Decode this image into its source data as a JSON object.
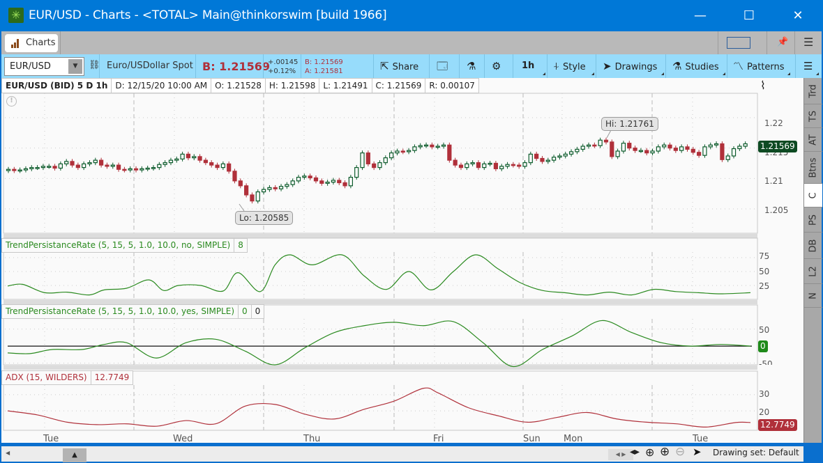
{
  "window": {
    "title": "EUR/USD - Charts - <TOTAL> Main@thinkorswim [build 1966]",
    "minimize": "—",
    "maximize": "☐",
    "close": "✕"
  },
  "tabbar": {
    "active_tab": "Charts"
  },
  "toolbar": {
    "symbol": "EUR/USD",
    "description": "Euro/USDollar Spot",
    "bid_big": "B: 1.21569",
    "change": "+.00145",
    "change_pct": "+0.12%",
    "bid": "B: 1.21569",
    "ask": "A: 1.21581",
    "share": "Share",
    "timeframe": "1h",
    "style": "Style",
    "drawings": "Drawings",
    "studies": "Studies",
    "patterns": "Patterns"
  },
  "infobar": {
    "title": "EUR/USD (BID) 5 D 1h",
    "date": "D: 12/15/20 10:00 AM",
    "open": "O: 1.21528",
    "high": "H: 1.21598",
    "low": "L: 1.21491",
    "close": "C: 1.21569",
    "range": "R: 0.00107"
  },
  "sidetabs": [
    "Trd",
    "TS",
    "AT",
    "Btns",
    "C",
    "PS",
    "DB",
    "L2",
    "N"
  ],
  "sidetab_active": "C",
  "price_axis": {
    "ticks": [
      "1.22",
      "1.215",
      "1.21",
      "1.205"
    ],
    "last": "1.21569"
  },
  "callouts": {
    "high": "Hi: 1.21761",
    "low": "Lo: 1.20585"
  },
  "panels": {
    "tpr_no": {
      "label": "TrendPersistanceRate (5, 15, 5, 1.0, 10.0, no, SIMPLE)",
      "value": "8",
      "ticks": [
        "75",
        "50",
        "25"
      ]
    },
    "tpr_yes": {
      "label": "TrendPersistanceRate (5, 15, 5, 1.0, 10.0, yes, SIMPLE)",
      "value1": "0",
      "value2": "0",
      "ticks": [
        "50",
        "-50"
      ],
      "last": "0"
    },
    "adx": {
      "label": "ADX (15, WILDERS)",
      "value": "12.7749",
      "ticks": [
        "30",
        "20"
      ],
      "last": "12.7749"
    }
  },
  "x_axis": [
    "Tue",
    "Wed",
    "Thu",
    "Fri",
    "Sun",
    "Mon",
    "Tue"
  ],
  "status": {
    "drawing_set": "Drawing set: Default"
  },
  "colors": {
    "up": "#0b5a2a",
    "down": "#b0303a",
    "tpr": "#2a8a1f",
    "adx": "#b0303a",
    "accent": "#0078d7",
    "toolbar": "#97dcfb"
  },
  "chart_data": [
    {
      "type": "candlestick",
      "title": "EUR/USD (BID) 5 D 1h",
      "ylim": [
        1.201,
        1.224
      ],
      "yticks": [
        1.205,
        1.21,
        1.215,
        1.22
      ],
      "close": [
        1.2115,
        1.2113,
        1.2114,
        1.2116,
        1.2118,
        1.2118,
        1.212,
        1.212,
        1.2117,
        1.2124,
        1.2128,
        1.2122,
        1.2118,
        1.2124,
        1.2126,
        1.213,
        1.2122,
        1.212,
        1.2122,
        1.2115,
        1.2114,
        1.2116,
        1.2114,
        1.2116,
        1.2117,
        1.2118,
        1.2123,
        1.2126,
        1.213,
        1.2132,
        1.214,
        1.2134,
        1.2136,
        1.213,
        1.2126,
        1.2122,
        1.2118,
        1.2124,
        1.2112,
        1.2096,
        1.2088,
        1.2073,
        1.2063,
        1.2078,
        1.2082,
        1.2085,
        1.2083,
        1.2087,
        1.209,
        1.2096,
        1.2102,
        1.2104,
        1.2101,
        1.2096,
        1.2092,
        1.2094,
        1.2097,
        1.2093,
        1.2088,
        1.2102,
        1.2118,
        1.2142,
        1.2124,
        1.2118,
        1.2126,
        1.2134,
        1.2142,
        1.2145,
        1.2144,
        1.2146,
        1.2152,
        1.2154,
        1.2155,
        1.2152,
        1.2153,
        1.2155,
        1.213,
        1.2122,
        1.2118,
        1.2124,
        1.2126,
        1.2118,
        1.2124,
        1.2125,
        1.2116,
        1.212,
        1.2123,
        1.2122,
        1.212,
        1.2126,
        1.214,
        1.2133,
        1.2128,
        1.213,
        1.2135,
        1.2137,
        1.214,
        1.2144,
        1.2148,
        1.2153,
        1.2155,
        1.2154,
        1.2163,
        1.216,
        1.2136,
        1.2145,
        1.2158,
        1.215,
        1.2146,
        1.2146,
        1.2142,
        1.2145,
        1.2152,
        1.2155,
        1.215,
        1.2146,
        1.2152,
        1.2148,
        1.2143,
        1.2138,
        1.2152,
        1.2155,
        1.2157,
        1.2131,
        1.2137,
        1.2149,
        1.2153,
        1.2157
      ]
    },
    {
      "type": "line",
      "title": "TrendPersistanceRate (5, 15, 5, 1.0, 10.0, no, SIMPLE)",
      "ylim": [
        0,
        85
      ],
      "yticks": [
        25,
        50,
        75
      ],
      "x": [
        0,
        0.02,
        0.05,
        0.08,
        0.11,
        0.13,
        0.16,
        0.19,
        0.21,
        0.23,
        0.26,
        0.29,
        0.31,
        0.34,
        0.36,
        0.38,
        0.41,
        0.45,
        0.48,
        0.51,
        0.54,
        0.57,
        0.6,
        0.63,
        0.66,
        0.69,
        0.72,
        0.75,
        0.78,
        0.81,
        0.84,
        0.87,
        0.9,
        0.93,
        0.96,
        1.0
      ],
      "values": [
        24,
        27,
        12,
        13,
        8,
        17,
        20,
        35,
        16,
        25,
        25,
        15,
        48,
        14,
        62,
        80,
        62,
        80,
        42,
        18,
        50,
        17,
        50,
        80,
        55,
        30,
        16,
        12,
        8,
        13,
        8,
        18,
        14,
        12,
        10,
        12
      ]
    },
    {
      "type": "line",
      "title": "TrendPersistanceRate (5, 15, 5, 1.0, 10.0, yes, SIMPLE)",
      "ylim": [
        -55,
        80
      ],
      "yticks": [
        -50,
        50
      ],
      "x": [
        0,
        0.03,
        0.06,
        0.1,
        0.13,
        0.16,
        0.2,
        0.24,
        0.28,
        0.32,
        0.36,
        0.4,
        0.44,
        0.48,
        0.52,
        0.56,
        0.6,
        0.64,
        0.68,
        0.72,
        0.76,
        0.8,
        0.84,
        0.88,
        0.92,
        0.96,
        1.0
      ],
      "values": [
        -20,
        -22,
        -10,
        -10,
        5,
        10,
        -35,
        10,
        20,
        -15,
        -55,
        -5,
        40,
        60,
        70,
        60,
        72,
        10,
        -60,
        -10,
        30,
        75,
        40,
        10,
        0,
        5,
        0
      ]
    },
    {
      "type": "line",
      "title": "ADX (15, WILDERS)",
      "ylim": [
        8,
        36
      ],
      "yticks": [
        20,
        30
      ],
      "x": [
        0,
        0.04,
        0.08,
        0.12,
        0.16,
        0.2,
        0.24,
        0.28,
        0.32,
        0.36,
        0.4,
        0.44,
        0.48,
        0.52,
        0.56,
        0.58,
        0.62,
        0.66,
        0.7,
        0.74,
        0.78,
        0.82,
        0.86,
        0.9,
        0.94,
        0.98,
        1.0
      ],
      "values": [
        20,
        17.5,
        13,
        11.5,
        12,
        10.5,
        14,
        12,
        23,
        24,
        18,
        15,
        21,
        26,
        34,
        31,
        22,
        17,
        13,
        16,
        19,
        15,
        13,
        12,
        10,
        12.8,
        12.8
      ]
    }
  ]
}
